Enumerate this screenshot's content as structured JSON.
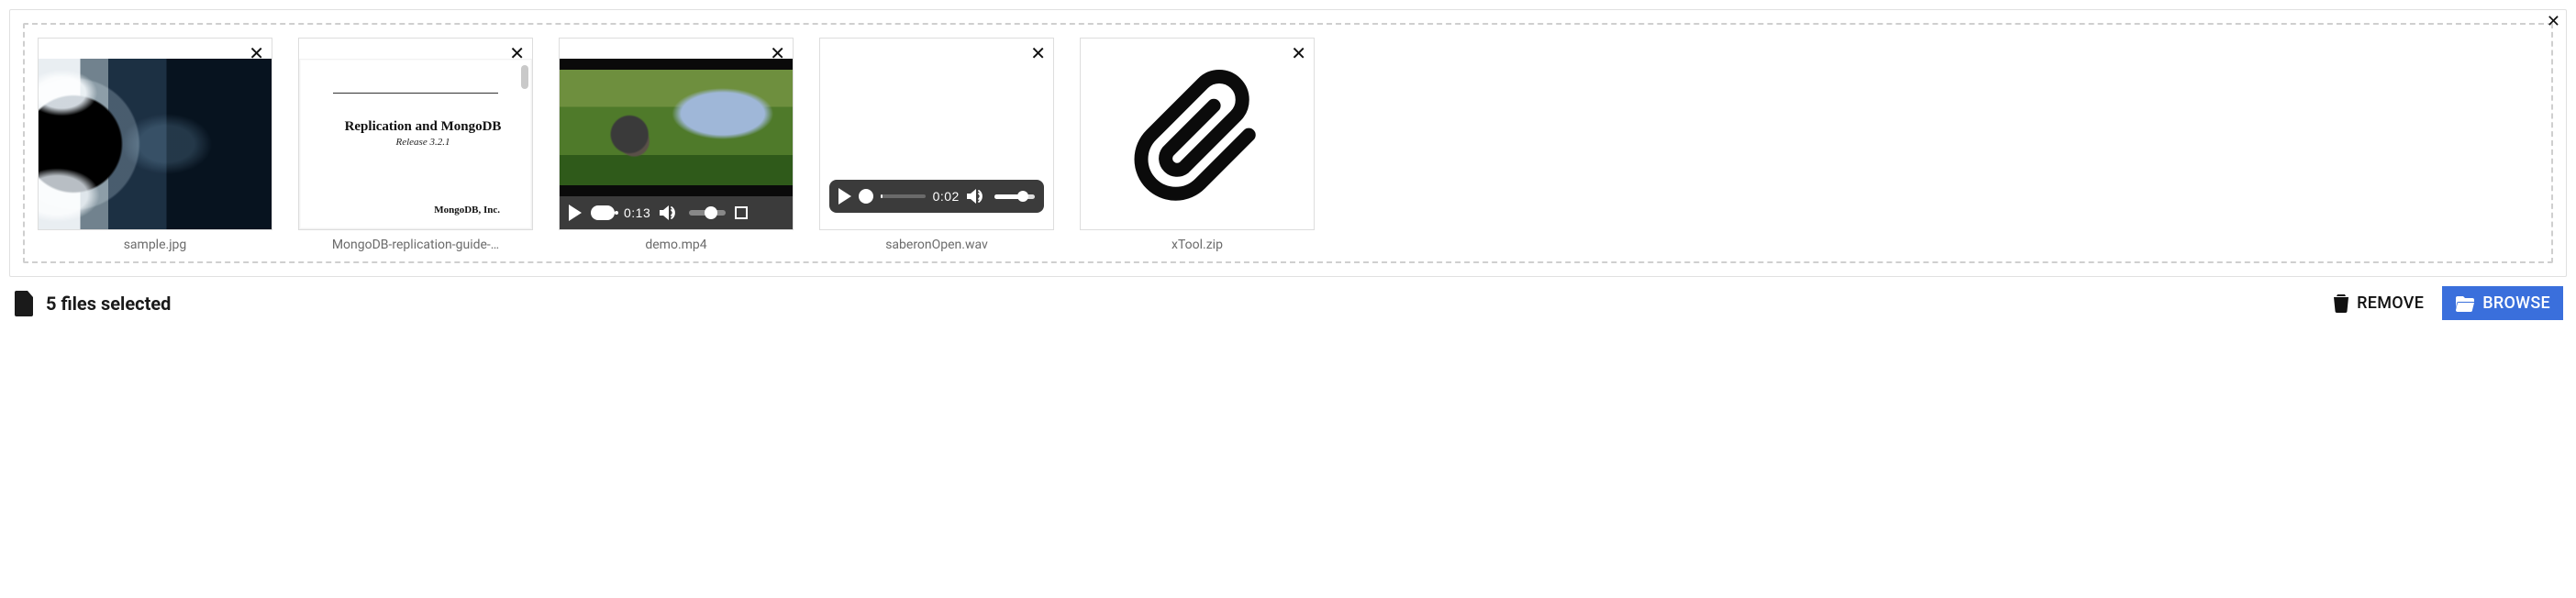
{
  "files": [
    {
      "label": "sample.jpg"
    },
    {
      "label": "MongoDB-replication-guide-…"
    },
    {
      "label": "demo.mp4"
    },
    {
      "label": "saberonOpen.wav"
    },
    {
      "label": "xTool.zip"
    }
  ],
  "doc": {
    "title": "Replication and MongoDB",
    "subtitle": "Release 3.2.1",
    "footer": "MongoDB, Inc."
  },
  "video": {
    "time": "0:13"
  },
  "audio": {
    "time": "0:02"
  },
  "status": "5 files selected",
  "buttons": {
    "remove": "REMOVE",
    "browse": "BROWSE"
  },
  "icons": {
    "close": "✕"
  }
}
